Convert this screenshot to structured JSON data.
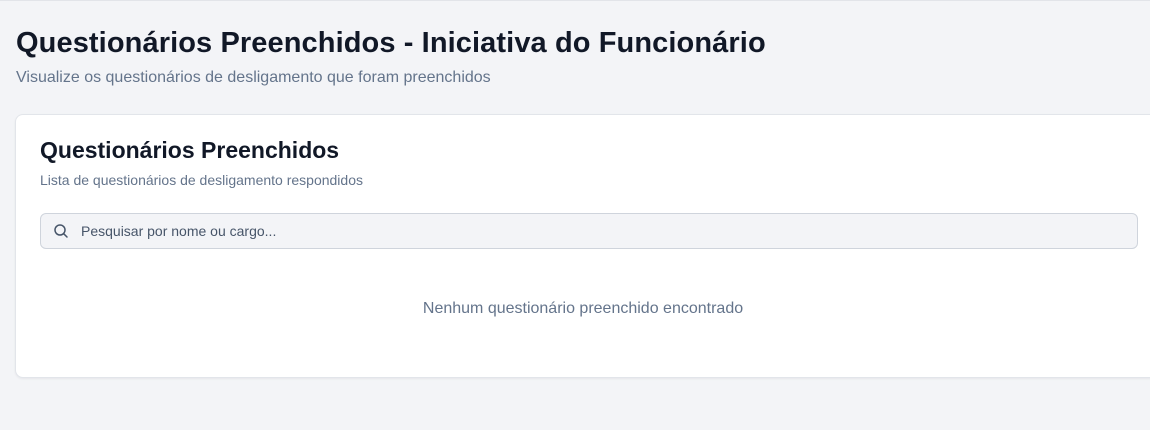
{
  "header": {
    "title": "Questionários Preenchidos - Iniciativa do Funcionário",
    "subtitle": "Visualize os questionários de desligamento que foram preenchidos"
  },
  "card": {
    "title": "Questionários Preenchidos",
    "subtitle": "Lista de questionários de desligamento respondidos",
    "search": {
      "placeholder": "Pesquisar por nome ou cargo...",
      "value": "",
      "icon": "search-icon"
    },
    "empty_message": "Nenhum questionário preenchido encontrado"
  },
  "colors": {
    "background": "#f3f4f7",
    "card": "#ffffff",
    "title": "#111827",
    "muted": "#64748b"
  }
}
